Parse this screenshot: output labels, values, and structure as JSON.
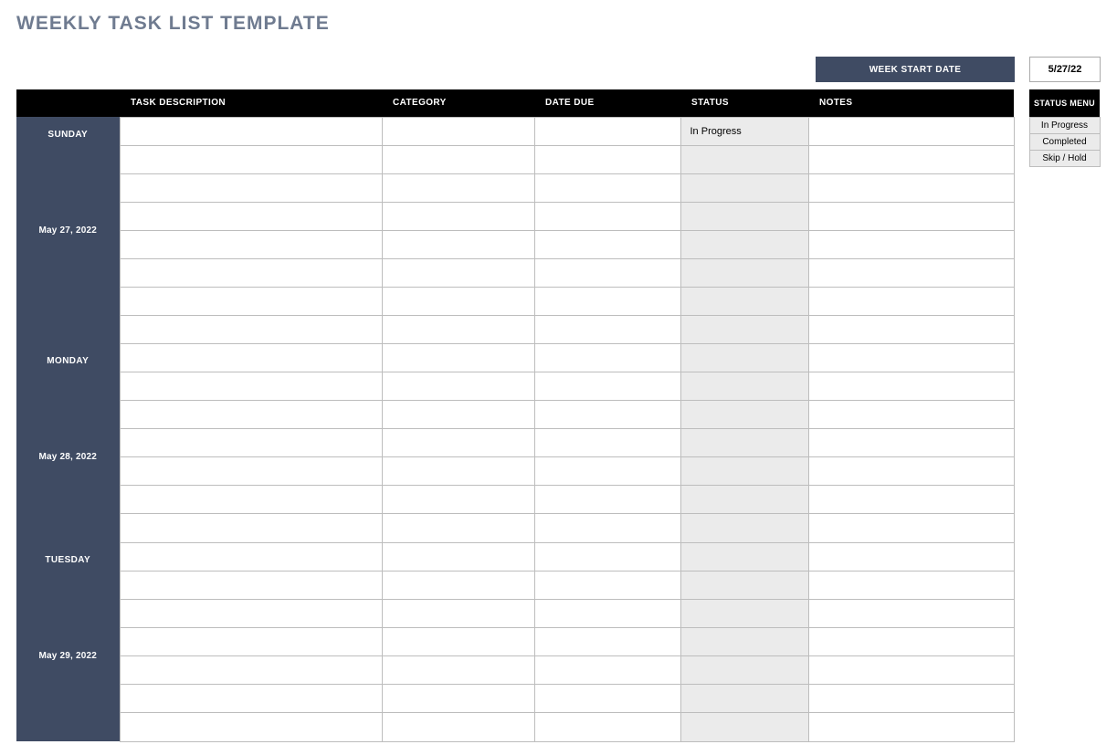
{
  "page_title": "WEEKLY TASK LIST TEMPLATE",
  "week_start": {
    "label": "WEEK START DATE",
    "value": "5/27/22"
  },
  "columns": {
    "day": "",
    "task": "TASK DESCRIPTION",
    "category": "CATEGORY",
    "due": "DATE DUE",
    "status": "STATUS",
    "notes": "NOTES"
  },
  "days": [
    {
      "name": "SUNDAY",
      "date": "May 27, 2022",
      "rows": [
        {
          "task": "",
          "category": "",
          "due": "",
          "status": "In Progress",
          "notes": ""
        },
        {
          "task": "",
          "category": "",
          "due": "",
          "status": "",
          "notes": ""
        },
        {
          "task": "",
          "category": "",
          "due": "",
          "status": "",
          "notes": ""
        },
        {
          "task": "",
          "category": "",
          "due": "",
          "status": "",
          "notes": ""
        },
        {
          "task": "",
          "category": "",
          "due": "",
          "status": "",
          "notes": ""
        },
        {
          "task": "",
          "category": "",
          "due": "",
          "status": "",
          "notes": ""
        },
        {
          "task": "",
          "category": "",
          "due": "",
          "status": "",
          "notes": ""
        },
        {
          "task": "",
          "category": "",
          "due": "",
          "status": "",
          "notes": ""
        }
      ]
    },
    {
      "name": "MONDAY",
      "date": "May 28, 2022",
      "rows": [
        {
          "task": "",
          "category": "",
          "due": "",
          "status": "",
          "notes": ""
        },
        {
          "task": "",
          "category": "",
          "due": "",
          "status": "",
          "notes": ""
        },
        {
          "task": "",
          "category": "",
          "due": "",
          "status": "",
          "notes": ""
        },
        {
          "task": "",
          "category": "",
          "due": "",
          "status": "",
          "notes": ""
        },
        {
          "task": "",
          "category": "",
          "due": "",
          "status": "",
          "notes": ""
        },
        {
          "task": "",
          "category": "",
          "due": "",
          "status": "",
          "notes": ""
        },
        {
          "task": "",
          "category": "",
          "due": "",
          "status": "",
          "notes": ""
        }
      ]
    },
    {
      "name": "TUESDAY",
      "date": "May 29, 2022",
      "rows": [
        {
          "task": "",
          "category": "",
          "due": "",
          "status": "",
          "notes": ""
        },
        {
          "task": "",
          "category": "",
          "due": "",
          "status": "",
          "notes": ""
        },
        {
          "task": "",
          "category": "",
          "due": "",
          "status": "",
          "notes": ""
        },
        {
          "task": "",
          "category": "",
          "due": "",
          "status": "",
          "notes": ""
        },
        {
          "task": "",
          "category": "",
          "due": "",
          "status": "",
          "notes": ""
        },
        {
          "task": "",
          "category": "",
          "due": "",
          "status": "",
          "notes": ""
        },
        {
          "task": "",
          "category": "",
          "due": "",
          "status": "",
          "notes": ""
        }
      ]
    }
  ],
  "status_menu": {
    "header": "STATUS MENU",
    "options": [
      "In Progress",
      "Completed",
      "Skip / Hold"
    ]
  }
}
